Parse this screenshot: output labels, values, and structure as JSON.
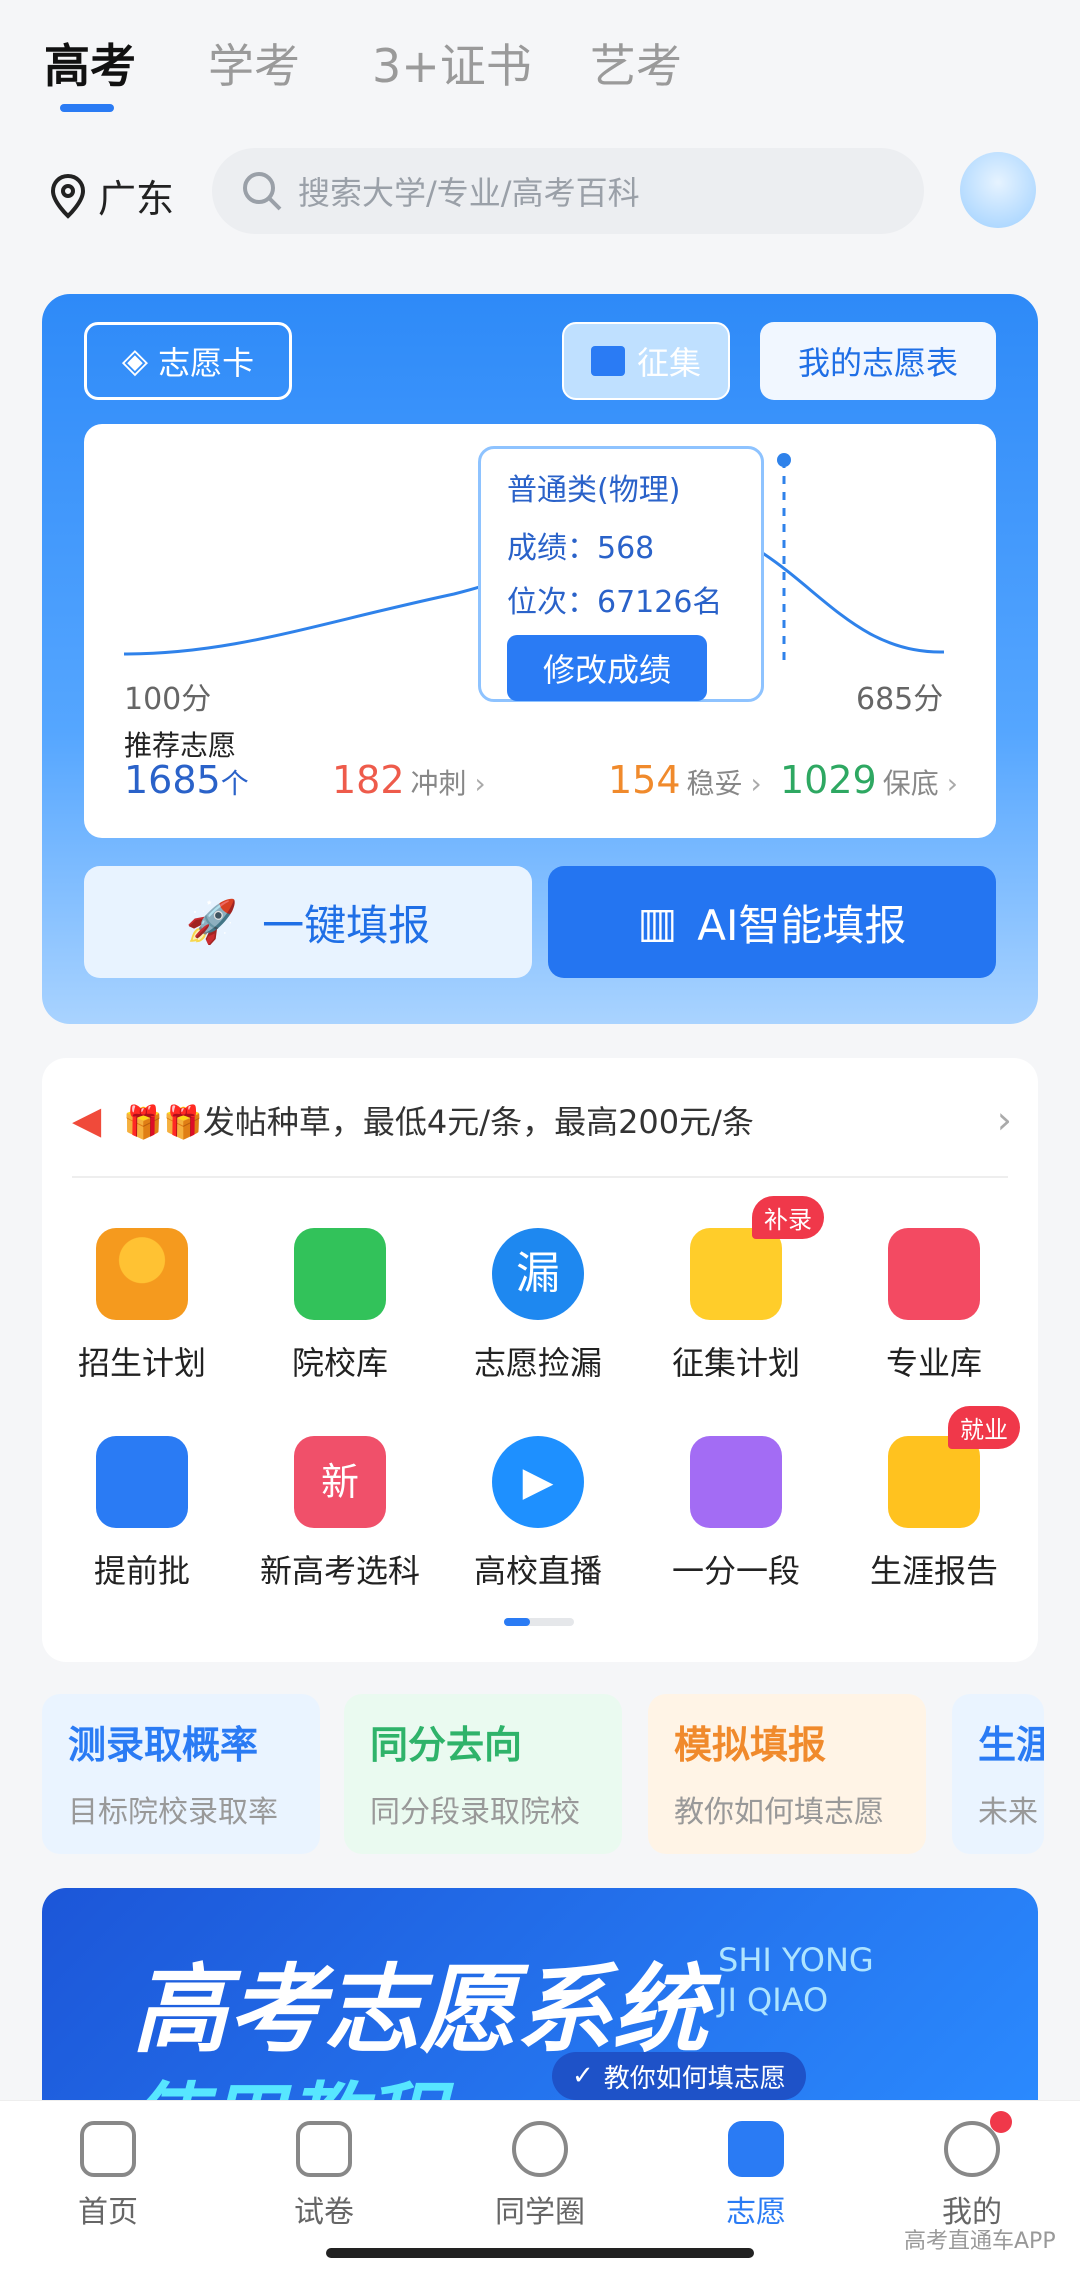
{
  "top_tabs": [
    "高考",
    "学考",
    "3+证书",
    "艺考"
  ],
  "location": "广东",
  "search": {
    "placeholder": "搜索大学/专业/高考百科"
  },
  "card": {
    "zhiyuan_card": "志愿卡",
    "zhengji": "征集",
    "my_table": "我的志愿表",
    "tooltip": {
      "category": "普通类(物理)",
      "score_label": "成绩：",
      "score": "568",
      "rank_label": "位次：",
      "rank": "67126名",
      "edit_btn": "修改成绩"
    },
    "axis_min": "100分",
    "axis_max": "685分",
    "recommend_label": "推荐志愿",
    "recommend_count": "1685",
    "recommend_unit": "个",
    "chong": {
      "value": "182",
      "label": "冲刺"
    },
    "wen": {
      "value": "154",
      "label": "稳妥"
    },
    "bao": {
      "value": "1029",
      "label": "保底"
    },
    "one_click": "一键填报",
    "ai_fill": "AI智能填报"
  },
  "notice": "🎁🎁发帖种草，最低4元/条，最高200元/条",
  "grid_items": [
    {
      "label": "招生计划"
    },
    {
      "label": "院校库"
    },
    {
      "label": "志愿捡漏"
    },
    {
      "label": "征集计划",
      "badge": "补录"
    },
    {
      "label": "专业库"
    },
    {
      "label": "提前批"
    },
    {
      "label": "新高考选科"
    },
    {
      "label": "高校直播"
    },
    {
      "label": "一分一段"
    },
    {
      "label": "生涯报告",
      "badge": "就业"
    }
  ],
  "quick_cards": [
    {
      "title": "测录取概率",
      "sub": "目标院校录取率"
    },
    {
      "title": "同分去向",
      "sub": "同分段录取院校"
    },
    {
      "title": "模拟填报",
      "sub": "教你如何填志愿"
    },
    {
      "title": "生涯",
      "sub": "未来"
    }
  ],
  "banner": {
    "title": "高考志愿系统",
    "subtitle": "使用教程",
    "en1": "SHI YONG",
    "en2": "JI QIAO",
    "tag": "教你如何填志愿"
  },
  "bottom_nav": [
    "首页",
    "试卷",
    "同学圈",
    "志愿",
    "我的"
  ],
  "watermark": "高考直通车APP"
}
